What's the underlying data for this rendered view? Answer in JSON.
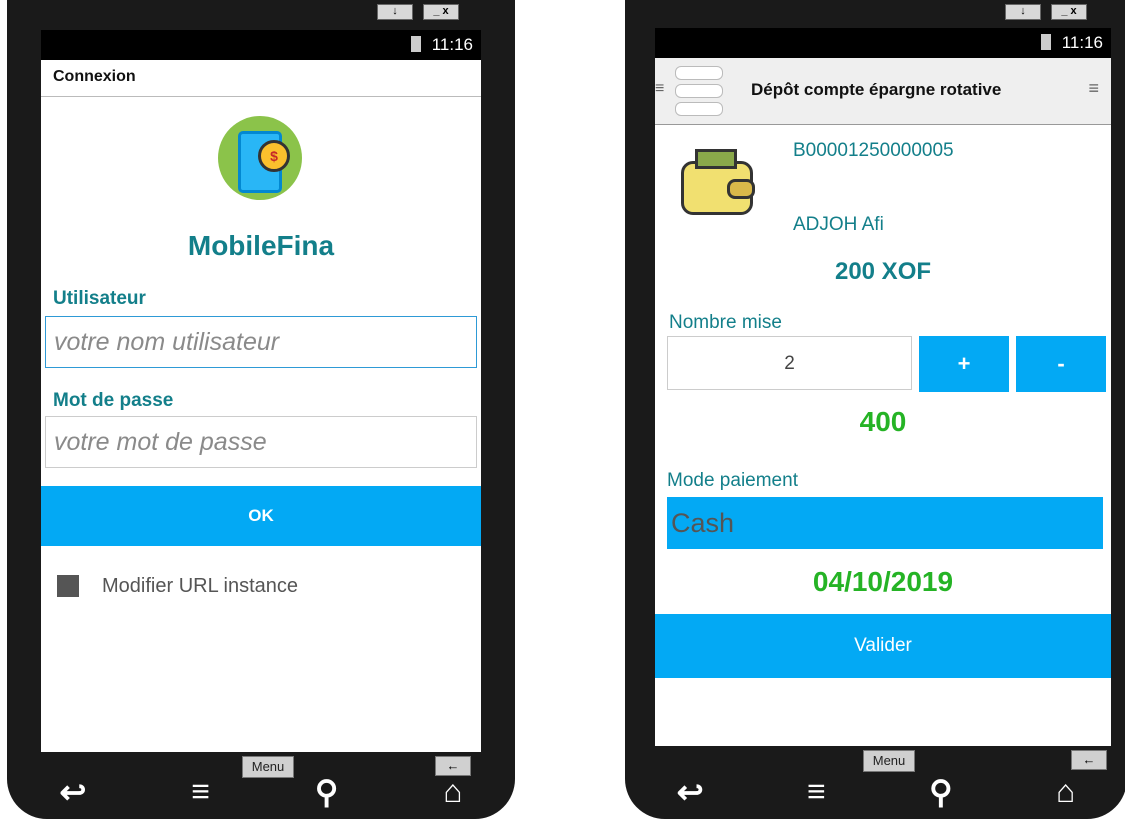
{
  "left_phone": {
    "status_time": "11:16",
    "title": "Connexion",
    "app_name": "MobileFina",
    "user_label": "Utilisateur",
    "user_placeholder": "votre nom utilisateur",
    "password_label": "Mot de passe",
    "password_placeholder": "votre mot de passe",
    "ok_label": "OK",
    "checkbox_label": "Modifier URL instance",
    "menu_key": "Menu"
  },
  "right_phone": {
    "status_time": "11:16",
    "title": "Dépôt compte épargne rotative",
    "account_number": "B00001250000005",
    "client_name": "ADJOH Afi",
    "amount": "200 XOF",
    "count_label": "Nombre mise",
    "count_value": "2",
    "plus_label": "+",
    "minus_label": "-",
    "total": "400",
    "payment_label": "Mode paiement",
    "payment_value": "Cash",
    "date": "04/10/2019",
    "submit_label": "Valider",
    "menu_key": "Menu"
  },
  "colors": {
    "accent": "#03a9f4",
    "teal_text": "#137f8a",
    "green_text": "#25b325"
  },
  "icons": [
    "battery-icon",
    "app-logo-icon",
    "wallet-icon",
    "hamburger-icon",
    "back-icon",
    "home-icon",
    "search-icon",
    "menu-icon"
  ]
}
